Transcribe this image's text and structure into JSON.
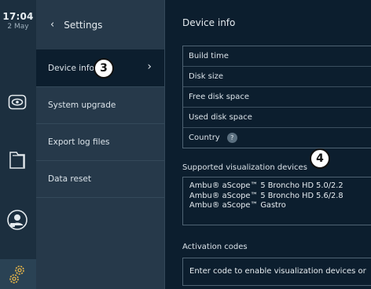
{
  "status": {
    "time": "17:04",
    "date": "2 May"
  },
  "menu": {
    "back_label": "Settings",
    "items": [
      {
        "label": "Device info",
        "active": true
      },
      {
        "label": "System upgrade"
      },
      {
        "label": "Export log files"
      },
      {
        "label": "Data reset"
      }
    ]
  },
  "main": {
    "title": "Device info",
    "info_rows": [
      "Build time",
      "Disk size",
      "Free disk space",
      "Used disk space",
      "Country"
    ],
    "country_help": "?",
    "supported_label": "Supported visualization devices",
    "supported_devices": [
      "Ambu® aScope™ 5 Broncho HD 5.0/2.2",
      "Ambu® aScope™ 5 Broncho HD 5.6/2.8",
      "Ambu® aScope™ Gastro"
    ],
    "activation_label": "Activation codes",
    "activation_placeholder": "Enter code to enable visualization devices or"
  },
  "callouts": {
    "menu_callout": "3",
    "main_callout": "4"
  },
  "colors": {
    "background": "#0c1e2e",
    "menu_bg": "#26394a",
    "rail_bg": "#1c2f3f",
    "accent_icon": "#e3b34a"
  }
}
